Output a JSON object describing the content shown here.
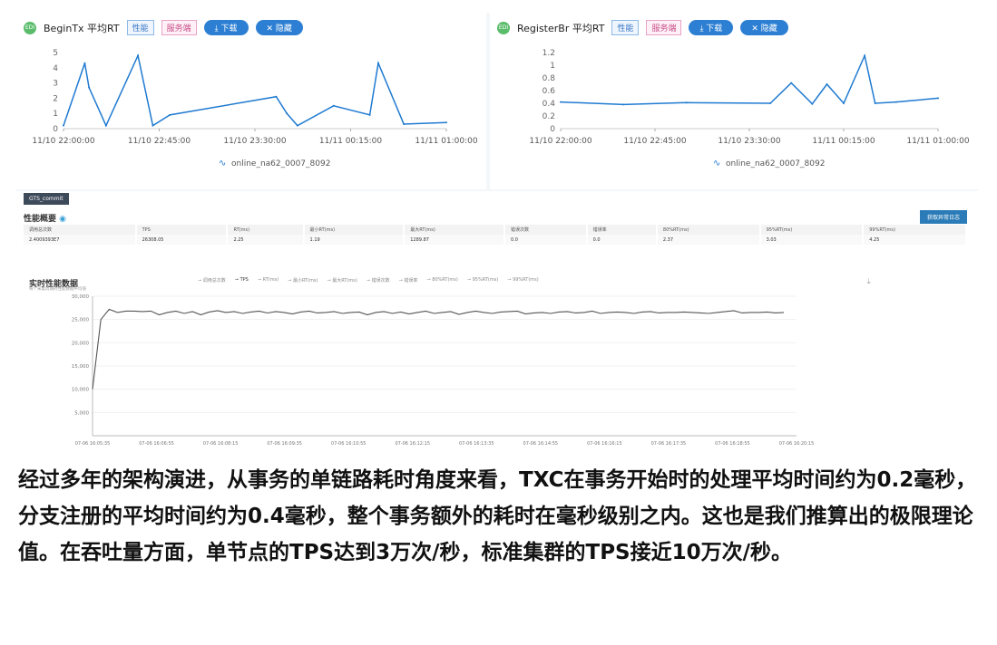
{
  "left_panel": {
    "logo": "EDI",
    "title": "BeginTx 平均RT",
    "tags": [
      "性能",
      "服务端"
    ],
    "download": "下载",
    "hide": "隐藏",
    "legend": "online_na62_0007_8092"
  },
  "right_panel": {
    "logo": "EDI",
    "title": "RegisterBr 平均RT",
    "tags": [
      "性能",
      "服务端"
    ],
    "download": "下载",
    "hide": "隐藏",
    "legend": "online_na62_0007_8092"
  },
  "lower": {
    "button": "GTS_commit",
    "overview_title": "性能概要",
    "export_label": "获取异常日志",
    "columns": [
      "调用总次数",
      "TPS",
      "RT(ms)",
      "最小RT(ms)",
      "最大RT(ms)",
      "错误次数",
      "错误率",
      "80%RT(ms)",
      "95%RT(ms)",
      "99%RT(ms)"
    ],
    "values": [
      "2.4009393E7",
      "26308.05",
      "2.25",
      "1.19",
      "1289.87",
      "0.0",
      "0.0",
      "2.37",
      "3.03",
      "4.25"
    ],
    "realtime_title": "实时性能数据",
    "realtime_sub": "每个采集周期的性能数据平均值",
    "legend": [
      "调用总次数",
      "TPS",
      "RT(ms)",
      "最小RT(ms)",
      "最大RT(ms)",
      "错误次数",
      "错误率",
      "80%RT(ms)",
      "95%RT(ms)",
      "99%RT(ms)"
    ]
  },
  "caption": "经过多年的架构演进，从事务的单链路耗时角度来看，TXC在事务开始时的处理平均时间约为0.2毫秒，分支注册的平均时间约为0.4毫秒，整个事务额外的耗时在毫秒级别之内。这也是我们推算出的极限理论值。在吞吐量方面，单节点的TPS达到3万次/秒，标准集群的TPS接近10万次/秒。",
  "colors": {
    "line_blue": "#1f7ad1",
    "line_gray": "#555555",
    "button_blue": "#2d7fd3"
  },
  "chart_data": [
    {
      "type": "line",
      "title": "BeginTx 平均RT",
      "x": [
        "11/10 22:00",
        "11/10 22:10",
        "11/10 22:12",
        "11/10 22:20",
        "11/10 22:35",
        "11/10 22:42",
        "11/10 22:50",
        "11/10 23:40",
        "11/10 23:45",
        "11/10 23:50",
        "11/11 00:07",
        "11/11 00:24",
        "11/11 00:28",
        "11/11 00:40",
        "11/11 01:00"
      ],
      "series": [
        {
          "name": "online_na62_0007_8092",
          "values": [
            0.2,
            4.3,
            2.7,
            0.2,
            4.8,
            0.2,
            0.9,
            2.1,
            1.0,
            0.2,
            1.5,
            0.9,
            4.3,
            0.3,
            0.4
          ]
        }
      ],
      "xticks": [
        "11/10 22:00:00",
        "11/10 22:45:00",
        "11/10 23:30:00",
        "11/11 00:15:00",
        "11/11 01:00:00"
      ],
      "ylim": [
        0,
        5
      ],
      "yticks": [
        0,
        1,
        2,
        3,
        4,
        5
      ]
    },
    {
      "type": "line",
      "title": "RegisterBr 平均RT",
      "x": [
        "11/10 22:00",
        "11/10 22:30",
        "11/10 23:00",
        "11/10 23:40",
        "11/10 23:50",
        "11/11 00:00",
        "11/11 00:07",
        "11/11 00:15",
        "11/11 00:25",
        "11/11 00:30",
        "11/11 00:40",
        "11/11 01:00"
      ],
      "series": [
        {
          "name": "online_na62_0007_8092",
          "values": [
            0.42,
            0.38,
            0.41,
            0.4,
            0.72,
            0.39,
            0.7,
            0.4,
            1.15,
            0.4,
            0.42,
            0.48
          ]
        }
      ],
      "xticks": [
        "11/10 22:00:00",
        "11/10 22:45:00",
        "11/10 23:30:00",
        "11/11 00:15:00",
        "11/11 01:00:00"
      ],
      "ylim": [
        0,
        1.2
      ],
      "yticks": [
        0,
        0.2,
        0.4,
        0.6,
        0.8,
        1,
        1.2
      ]
    },
    {
      "type": "line",
      "title": "实时性能数据",
      "series": [
        {
          "name": "TPS",
          "values": [
            10000,
            25000,
            27200,
            26500,
            26800,
            26800,
            26700,
            26800,
            26000,
            26500,
            26800,
            26300,
            26700,
            26000,
            26600,
            26900,
            26500,
            26700,
            26300,
            26600,
            26800,
            26400,
            26700,
            26500,
            26200,
            26600,
            26800,
            26400,
            26500,
            26700,
            26300,
            26500,
            26600,
            26000,
            26500,
            26700,
            26300,
            26600,
            26200,
            26500,
            26800,
            26300,
            26500,
            26700,
            26100,
            26500,
            26800,
            26500,
            26300,
            26600,
            26700,
            26800,
            26200,
            26400,
            26500,
            26300,
            26600,
            26700,
            26400,
            26500,
            26800,
            26300,
            26500,
            26600,
            26500,
            26300,
            26600,
            26700,
            26400,
            26500,
            26500,
            26600,
            26500,
            26400,
            26300,
            26500,
            26700,
            26900,
            26400,
            26500,
            26500,
            26600,
            26400,
            26500
          ]
        }
      ],
      "xticks": [
        "07-06 16:05:35",
        "07-06 16:06:55",
        "07-06 16:08:15",
        "07-06 16:09:35",
        "07-06 16:10:55",
        "07-06 16:12:15",
        "07-06 16:13:35",
        "07-06 16:14:55",
        "07-06 16:16:15",
        "07-06 16:17:35",
        "07-06 16:18:55",
        "07-06 16:20:15"
      ],
      "ylim": [
        0,
        30000
      ],
      "yticks": [
        "5,000",
        "10,000",
        "15,000",
        "20,000",
        "25,000",
        "30,000"
      ]
    }
  ]
}
